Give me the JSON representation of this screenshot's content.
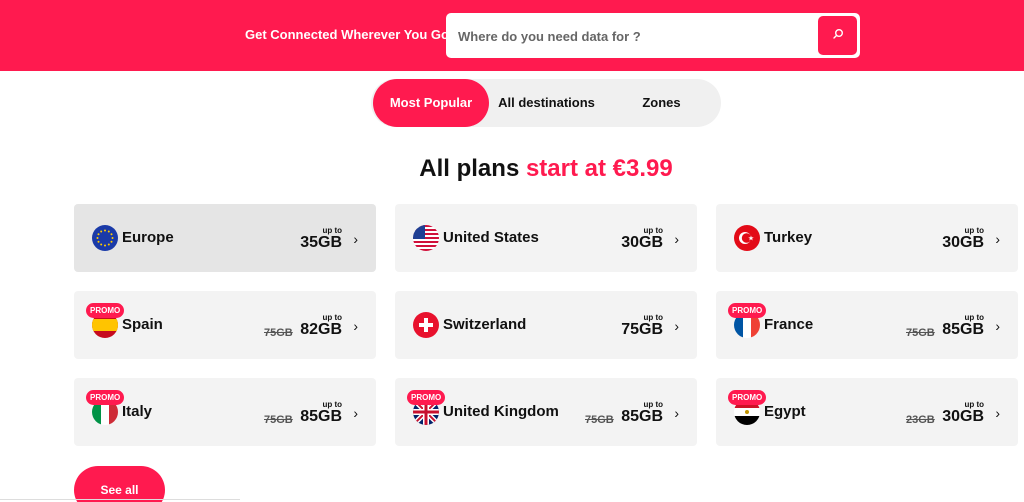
{
  "header": {
    "title": "Get Connected Wherever You Go",
    "search_placeholder": "Where do you need data for ?"
  },
  "tabs": [
    {
      "label": "Most Popular",
      "active": true
    },
    {
      "label": "All destinations",
      "active": false
    },
    {
      "label": "Zones",
      "active": false
    }
  ],
  "headline": {
    "prefix": "All plans ",
    "accent": "start at €3.99"
  },
  "colors": {
    "accent": "#ff1a4f",
    "card_bg": "#f3f3f3"
  },
  "upto_label": "up to",
  "promo_label": "PROMO",
  "destinations": [
    {
      "name": "Europe",
      "data": "35GB",
      "old_data": "",
      "promo": false
    },
    {
      "name": "United States",
      "data": "30GB",
      "old_data": "",
      "promo": false
    },
    {
      "name": "Turkey",
      "data": "30GB",
      "old_data": "",
      "promo": false
    },
    {
      "name": "Spain",
      "data": "82GB",
      "old_data": "75GB",
      "promo": true
    },
    {
      "name": "Switzerland",
      "data": "75GB",
      "old_data": "",
      "promo": false
    },
    {
      "name": "France",
      "data": "85GB",
      "old_data": "75GB",
      "promo": true
    },
    {
      "name": "Italy",
      "data": "85GB",
      "old_data": "75GB",
      "promo": true
    },
    {
      "name": "United Kingdom",
      "data": "85GB",
      "old_data": "75GB",
      "promo": true
    },
    {
      "name": "Egypt",
      "data": "30GB",
      "old_data": "23GB",
      "promo": true
    }
  ],
  "see_all_label": "See all"
}
